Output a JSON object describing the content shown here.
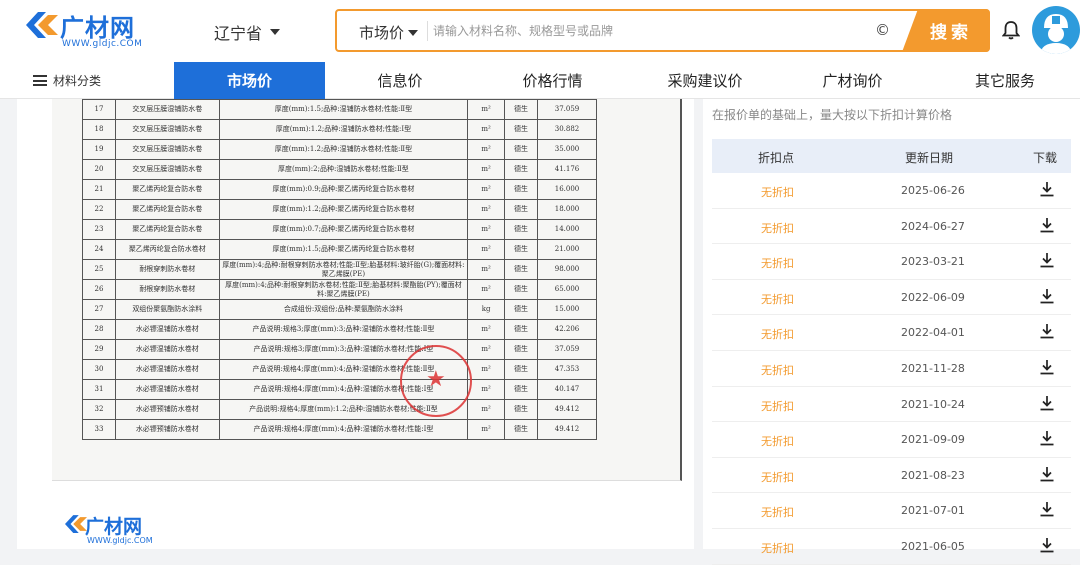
{
  "header": {
    "logo_name": "广材网",
    "logo_url": "WWW.gldjc.COM",
    "province": "辽宁省",
    "search": {
      "type": "市场价",
      "placeholder": "请输入材料名称、规格型号或品牌",
      "copy_symbol": "©",
      "button": "搜索"
    }
  },
  "nav": {
    "category": "材料分类",
    "tabs": [
      {
        "label": "市场价"
      },
      {
        "label": "信息价"
      },
      {
        "label": "价格行情"
      },
      {
        "label": "采购建议价"
      },
      {
        "label": "广材询价"
      },
      {
        "label": "其它服务"
      }
    ]
  },
  "document": {
    "rows": [
      {
        "no": "17",
        "name": "交叉层压膜湿铺防水卷",
        "spec": "厚度(mm):1.5;品种:湿铺防水卷材;性能:Ⅱ型",
        "unit": "m²",
        "brand": "德生",
        "price": "37.059"
      },
      {
        "no": "18",
        "name": "交叉层压膜湿铺防水卷",
        "spec": "厚度(mm):1.2;品种:湿铺防水卷材;性能:Ⅰ型",
        "unit": "m²",
        "brand": "德生",
        "price": "30.882"
      },
      {
        "no": "19",
        "name": "交叉层压膜湿铺防水卷",
        "spec": "厚度(mm):1.2;品种:湿铺防水卷材;性能:Ⅱ型",
        "unit": "m²",
        "brand": "德生",
        "price": "35.000"
      },
      {
        "no": "20",
        "name": "交叉层压膜湿铺防水卷",
        "spec": "厚度(mm):2;品种:湿铺防水卷材;性能:Ⅱ型",
        "unit": "m²",
        "brand": "德生",
        "price": "41.176"
      },
      {
        "no": "21",
        "name": "聚乙烯丙纶复合防水卷",
        "spec": "厚度(mm):0.9;品种:聚乙烯丙纶复合防水卷材",
        "unit": "m²",
        "brand": "德生",
        "price": "16.000"
      },
      {
        "no": "22",
        "name": "聚乙烯丙纶复合防水卷",
        "spec": "厚度(mm):1.2;品种:聚乙烯丙纶复合防水卷材",
        "unit": "m²",
        "brand": "德生",
        "price": "18.000"
      },
      {
        "no": "23",
        "name": "聚乙烯丙纶复合防水卷",
        "spec": "厚度(mm):0.7;品种:聚乙烯丙纶复合防水卷材",
        "unit": "m²",
        "brand": "德生",
        "price": "14.000"
      },
      {
        "no": "24",
        "name": "聚乙烯丙纶复合防水卷材",
        "spec": "厚度(mm):1.5;品种:聚乙烯丙纶复合防水卷材",
        "unit": "m²",
        "brand": "德生",
        "price": "21.000"
      },
      {
        "no": "25",
        "name": "耐根穿刺防水卷材",
        "spec": "厚度(mm):4;品种:耐根穿刺防水卷材;性能:Ⅱ型;胎基材料:玻纤胎(G);覆面材料:聚乙烯膜(PE)",
        "unit": "m²",
        "brand": "德生",
        "price": "98.000"
      },
      {
        "no": "26",
        "name": "耐根穿刺防水卷材",
        "spec": "厚度(mm):4;品种:耐根穿刺防水卷材;性能:Ⅱ型;胎基材料:聚酯胎(PY);覆面材料:聚乙烯膜(PE)",
        "unit": "m²",
        "brand": "德生",
        "price": "65.000"
      },
      {
        "no": "27",
        "name": "双组份聚氨酯防水涂料",
        "spec": "合成组份:双组份;品种:聚氨酯防水涂料",
        "unit": "kg",
        "brand": "德生",
        "price": "15.000"
      },
      {
        "no": "28",
        "name": "水必镖湿铺防水卷材",
        "spec": "产品说明:规格3;厚度(mm):3;品种:湿铺防水卷材;性能:Ⅱ型",
        "unit": "m²",
        "brand": "德生",
        "price": "42.206"
      },
      {
        "no": "29",
        "name": "水必镖湿铺防水卷材",
        "spec": "产品说明:规格3;厚度(mm):3;品种:湿铺防水卷材;性能:Ⅰ型",
        "unit": "m²",
        "brand": "德生",
        "price": "37.059"
      },
      {
        "no": "30",
        "name": "水必镖湿铺防水卷材",
        "spec": "产品说明:规格4;厚度(mm):4;品种:湿铺防水卷材;性能:Ⅱ型",
        "unit": "m²",
        "brand": "德生",
        "price": "47.353"
      },
      {
        "no": "31",
        "name": "水必镖湿铺防水卷材",
        "spec": "产品说明:规格4;厚度(mm):4;品种:湿铺防水卷材;性能:Ⅰ型",
        "unit": "m²",
        "brand": "德生",
        "price": "40.147"
      },
      {
        "no": "32",
        "name": "水必镖预铺防水卷材",
        "spec": "产品说明:规格4;厚度(mm):1.2;品种:湿铺防水卷材;性能:Ⅱ型",
        "unit": "m²",
        "brand": "德生",
        "price": "49.412"
      },
      {
        "no": "33",
        "name": "水必镖预铺防水卷材",
        "spec": "产品说明:规格4;厚度(mm):4;品种:湿铺防水卷材;性能:Ⅰ型",
        "unit": "m²",
        "brand": "德生",
        "price": "49.412"
      }
    ]
  },
  "footer_logo": {
    "name": "广材网",
    "url": "WWW.gldjc.COM"
  },
  "sidebar": {
    "hint": "在报价单的基础上，量大按以下折扣计算价格",
    "headers": {
      "discount": "折扣点",
      "date": "更新日期",
      "download": "下载"
    },
    "rows": [
      {
        "discount": "无折扣",
        "date": "2025-06-26"
      },
      {
        "discount": "无折扣",
        "date": "2024-06-27"
      },
      {
        "discount": "无折扣",
        "date": "2023-03-21"
      },
      {
        "discount": "无折扣",
        "date": "2022-06-09"
      },
      {
        "discount": "无折扣",
        "date": "2022-04-01"
      },
      {
        "discount": "无折扣",
        "date": "2021-11-28"
      },
      {
        "discount": "无折扣",
        "date": "2021-10-24"
      },
      {
        "discount": "无折扣",
        "date": "2021-09-09"
      },
      {
        "discount": "无折扣",
        "date": "2021-08-23"
      },
      {
        "discount": "无折扣",
        "date": "2021-07-01"
      },
      {
        "discount": "无折扣",
        "date": "2021-06-05"
      }
    ]
  },
  "colors": {
    "brand": "#1e6fd9",
    "accent": "#f39a2e"
  }
}
